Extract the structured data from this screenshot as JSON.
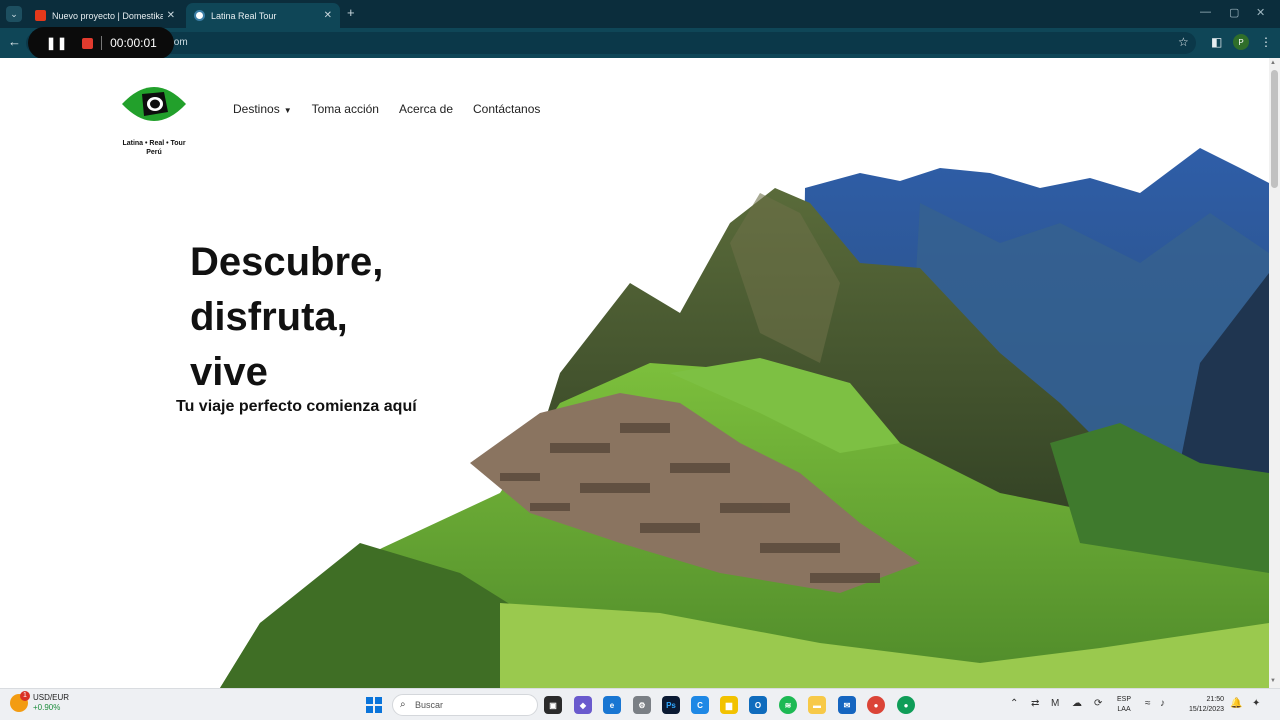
{
  "browser": {
    "tabs": [
      {
        "title": "Nuevo proyecto | Domestika",
        "active": false
      },
      {
        "title": "Latina Real Tour",
        "active": true
      }
    ],
    "url_visible": ".com",
    "recorder": {
      "time": "00:00:01"
    },
    "profile_initial": "P"
  },
  "site": {
    "logo_lines": [
      "Latina • Real • Tour",
      "Perú"
    ],
    "nav": [
      {
        "label": "Destinos",
        "has_dropdown": true
      },
      {
        "label": "Toma acción"
      },
      {
        "label": "Acerca de"
      },
      {
        "label": "Contáctanos"
      }
    ],
    "hero": {
      "headline": [
        "Descubre,",
        "disfruta,",
        "vive"
      ],
      "subheadline": "Tu viaje perfecto comienza aquí"
    }
  },
  "taskbar": {
    "weather": {
      "pair": "USD/EUR",
      "change": "+0.90%",
      "badge": "1"
    },
    "search_placeholder": "Buscar",
    "language": [
      "ESP",
      "LAA"
    ],
    "time": "21:50",
    "date": "15/12/2023"
  },
  "colors": {
    "tabbar": "#0b2d3c",
    "addressbar": "#0f4657",
    "logo_green": "#22a02b"
  }
}
